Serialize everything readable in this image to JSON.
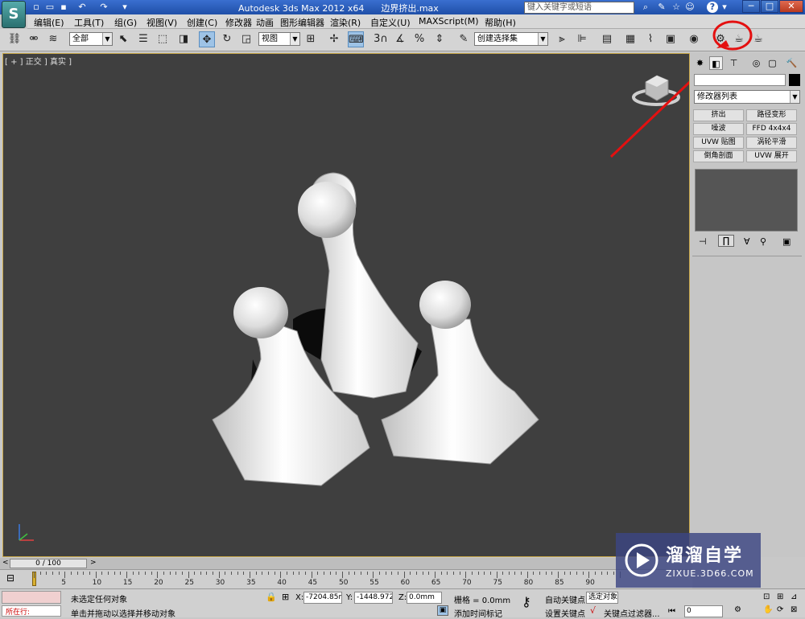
{
  "titlebar": {
    "app_name": "Autodesk 3ds Max  2012 x64",
    "file_name": "边界挤出.max",
    "search_placeholder": "键入关键字或短语",
    "help_icon": "?",
    "minimize": "─",
    "maximize": "□",
    "close": "✕"
  },
  "menu": [
    "编辑(E)",
    "工具(T)",
    "组(G)",
    "视图(V)",
    "创建(C)",
    "修改器",
    "动画",
    "图形编辑器",
    "渲染(R)",
    "自定义(U)",
    "MAXScript(M)",
    "帮助(H)"
  ],
  "toolbar": {
    "selection_filter": "全部",
    "reference_coord": "视图",
    "snap_label": "3",
    "named_selection": "创建选择集"
  },
  "viewport": {
    "label": "[ + ] 正交 ] 真实 ]",
    "background": "#3f3f3f",
    "object_color": "#e6e6e6"
  },
  "command_panel": {
    "modifier_list": "修改器列表",
    "buttons": [
      {
        "label": "挤出"
      },
      {
        "label": "路径变形"
      },
      {
        "label": "噪波"
      },
      {
        "label": "FFD 4x4x4"
      },
      {
        "label": "UVW 贴图"
      },
      {
        "label": "涡轮平滑"
      },
      {
        "label": "倒角剖面"
      },
      {
        "label": "UVW 展开"
      }
    ]
  },
  "timeline": {
    "frame_counter": "0 / 100",
    "ticks": [
      "5",
      "10",
      "15",
      "20",
      "25",
      "30",
      "35",
      "40",
      "45",
      "50",
      "55",
      "60",
      "65",
      "70",
      "75",
      "80",
      "85",
      "90"
    ]
  },
  "status": {
    "script_label": "所在行:",
    "selection_status": "未选定任何对象",
    "prompt": "单击并拖动以选择并移动对象",
    "x_label": "X:",
    "x_value": "-7204.85m",
    "y_label": "Y:",
    "y_value": "-1448.972r",
    "z_label": "Z:",
    "z_value": "0.0mm",
    "grid": "栅格 = 0.0mm",
    "add_time_tag": "添加时间标记",
    "auto_key": "自动关键点",
    "set_key": "设置关键点",
    "selected_object": "选定对象",
    "key_filters": "关键点过滤器...",
    "frame_value": "0"
  },
  "watermark": {
    "brand": "溜溜自学",
    "url": "ZIXUE.3D66.COM"
  },
  "colors": {
    "annotation_red": "#e41010",
    "viewport_border": "#c9a84a"
  }
}
